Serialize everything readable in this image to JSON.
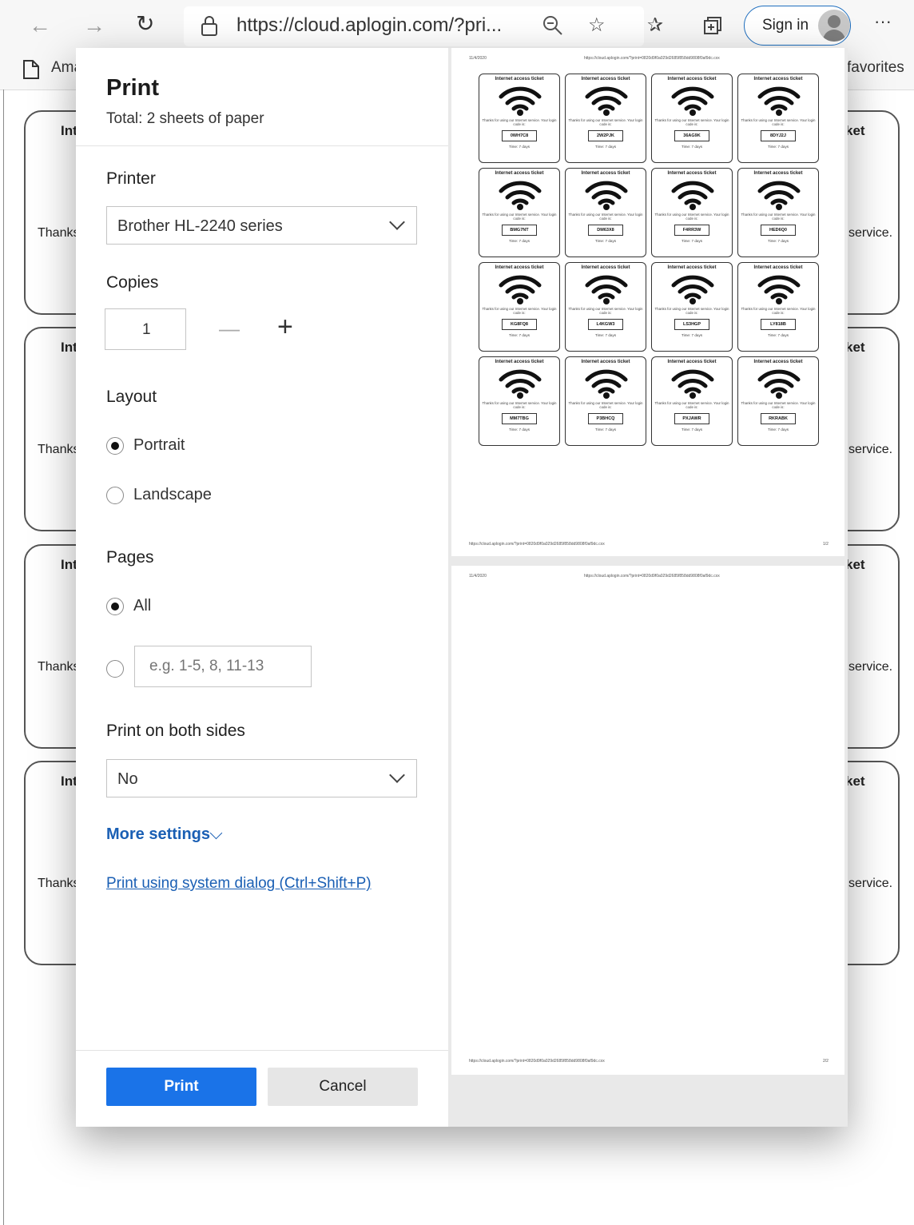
{
  "browser": {
    "url": "https://cloud.aplogin.com/?pri...",
    "sign_in_label": "Sign in",
    "more_label": "···",
    "favorites_left": "Ama",
    "favorites_right": "favorites"
  },
  "background_page": {
    "card_title_left": "Int",
    "card_title_right": "ket",
    "card_text_left": "Thanks",
    "card_text_right": "service."
  },
  "dialog": {
    "title": "Print",
    "total": "Total: 2 sheets of paper",
    "printer": {
      "label": "Printer",
      "value": "Brother HL-2240 series"
    },
    "copies": {
      "label": "Copies",
      "value": "1",
      "minus": "—",
      "plus": "+"
    },
    "layout": {
      "label": "Layout",
      "options": [
        "Portrait",
        "Landscape"
      ],
      "selected": "Portrait"
    },
    "pages": {
      "label": "Pages",
      "all_label": "All",
      "range_placeholder": "e.g. 1-5, 8, 11-13",
      "selected": "All"
    },
    "duplex": {
      "label": "Print on both sides",
      "value": "No"
    },
    "more_settings": "More settings",
    "system_dialog_link": "Print using system dialog (Ctrl+Shift+P)",
    "print_button": "Print",
    "cancel_button": "Cancel"
  },
  "preview": {
    "header_date": "11/4/2020",
    "header_url": "https://cloud.aplogin.com/?print=0820d9f0a029d2685f858dd9808f0af9dc.cxx",
    "footer_url": "https://cloud.aplogin.com/?print=0820d9f0a029d2685f858dd9808f0af9dc.cxx",
    "page1_number": "1/2",
    "page2_number": "2/2",
    "ticket": {
      "title": "Internet access ticket",
      "text": "Thanks for using our Internet service. Your login code is:",
      "time": "Time: 7 days"
    },
    "codes": [
      "0WH7C8",
      "2W2PJK",
      "36AG9K",
      "8DYJ2J",
      "BMG7NT",
      "DM63X8",
      "F4RR3W",
      "HED6Q0",
      "KG8FQ8",
      "L4KGW3",
      "LS3HGP",
      "LY818B",
      "MM7TBG",
      "P3BHCQ",
      "PXJAWR",
      "RKRABK"
    ]
  },
  "colors": {
    "accent": "#1a73e8",
    "link": "#1a5fb4"
  }
}
